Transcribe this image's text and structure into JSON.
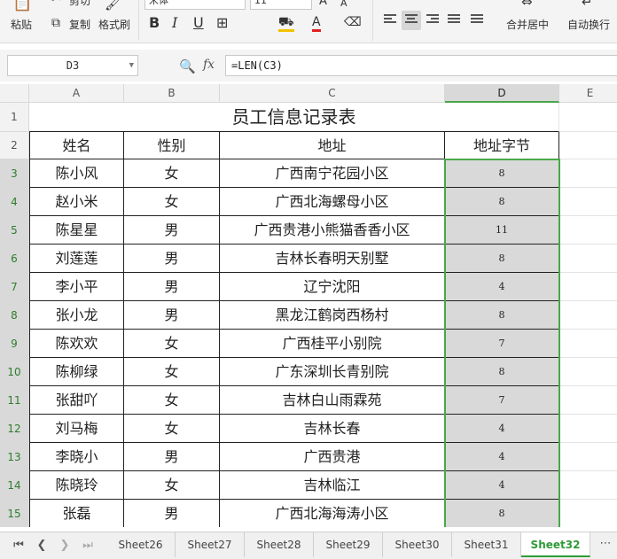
{
  "ribbon": {
    "cut_label": "剪切",
    "paste_label": "粘贴",
    "copy_label": "复制",
    "format_painter_label": "格式刷",
    "font_name": "宋体",
    "font_size": "11",
    "merge_center_label": "合并居中",
    "wrap_text_label": "自动换行"
  },
  "formula_bar": {
    "name_box": "D3",
    "formula": "=LEN(C3)"
  },
  "columns": [
    "A",
    "B",
    "C",
    "D",
    "E"
  ],
  "rows": [
    "1",
    "2",
    "3",
    "4",
    "5",
    "6",
    "7",
    "8",
    "9",
    "10",
    "11",
    "12",
    "13",
    "14",
    "15"
  ],
  "table": {
    "title": "员工信息记录表",
    "headers": [
      "姓名",
      "性别",
      "地址",
      "地址字节"
    ],
    "records": [
      [
        "陈小风",
        "女",
        "广西南宁花园小区",
        "8"
      ],
      [
        "赵小米",
        "女",
        "广西北海螺母小区",
        "8"
      ],
      [
        "陈星星",
        "男",
        "广西贵港小熊猫香香小区",
        "11"
      ],
      [
        "刘莲莲",
        "男",
        "吉林长春明天别墅",
        "8"
      ],
      [
        "李小平",
        "男",
        "辽宁沈阳",
        "4"
      ],
      [
        "张小龙",
        "男",
        "黑龙江鹤岗西杨村",
        "8"
      ],
      [
        "陈欢欢",
        "女",
        "广西桂平小别院",
        "7"
      ],
      [
        "陈柳绿",
        "女",
        "广东深圳长青别院",
        "8"
      ],
      [
        "张甜吖",
        "女",
        "吉林白山雨霖苑",
        "7"
      ],
      [
        "刘马梅",
        "女",
        "吉林长春",
        "4"
      ],
      [
        "李晓小",
        "男",
        "广西贵港",
        "4"
      ],
      [
        "陈晓玲",
        "女",
        "吉林临江",
        "4"
      ],
      [
        "张磊",
        "男",
        "广西北海海涛小区",
        "8"
      ]
    ]
  },
  "sheet_tabs": [
    "Sheet26",
    "Sheet27",
    "Sheet28",
    "Sheet29",
    "Sheet30",
    "Sheet31",
    "Sheet32"
  ],
  "active_sheet": "Sheet32",
  "colors": {
    "accent_green": "#4aa74a",
    "selection_fill": "#d9d9d9"
  }
}
